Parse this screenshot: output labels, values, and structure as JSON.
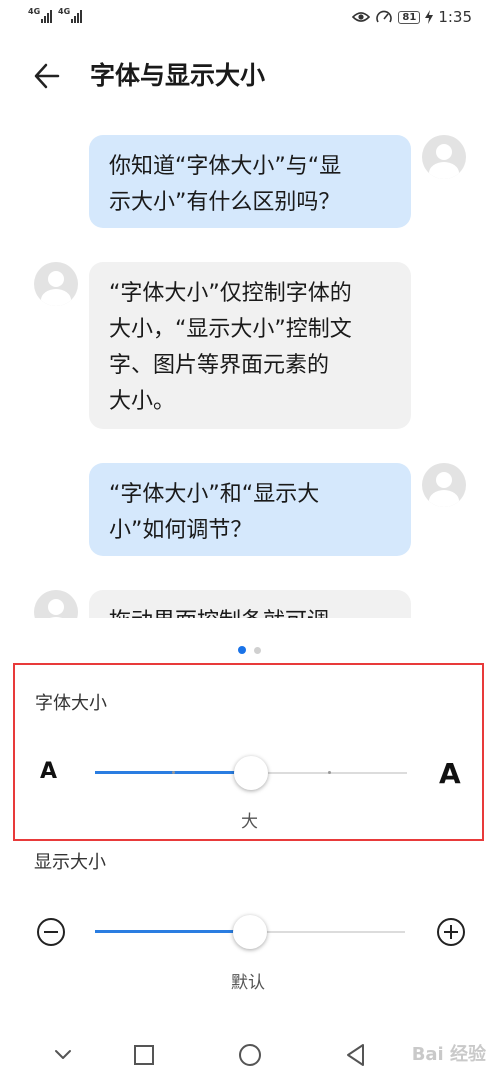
{
  "status_bar": {
    "signal_1": "4G",
    "signal_2": "4G",
    "battery": "81",
    "time": "1:35",
    "icons": [
      "eye-icon",
      "speedometer-icon",
      "battery-icon",
      "charging-icon"
    ]
  },
  "header": {
    "back_icon": "arrow-left-icon",
    "title": "字体与显示大小"
  },
  "preview": {
    "messages": [
      {
        "from": "me",
        "line1": "你知道“字体大小”与“显",
        "line2": "示大小”有什么区别吗？"
      },
      {
        "from": "other",
        "line1": "“字体大小”仅控制字体的",
        "line2": "大小，“显示大小”控制文",
        "line3": "字、图片等界面元素的",
        "line4": "大小。"
      },
      {
        "from": "me",
        "line1": "“字体大小”和“显示大",
        "line2": "小”如何调节？"
      },
      {
        "from": "other",
        "line1": "拖动界面控制条就可调"
      }
    ],
    "page_count": 2,
    "active_page": 1
  },
  "font_size": {
    "label": "字体大小",
    "small_a": "A",
    "large_a": "A",
    "value_label": "大",
    "level_fraction": 0.5
  },
  "display_size": {
    "label": "显示大小",
    "minus_icon": "minus-circle-icon",
    "plus_icon": "plus-circle-icon",
    "value_label": "默认",
    "level_fraction": 0.5
  },
  "nav_bar": {
    "icons": [
      "chevron-down-icon",
      "square-icon",
      "circle-icon",
      "triangle-back-icon"
    ]
  },
  "watermark": "Bai 经验",
  "colors": {
    "accent": "#2a7de1",
    "highlight_border": "#e83a3a",
    "bubble_me": "#d5e8fc",
    "bubble_other": "#f1f1f1"
  }
}
